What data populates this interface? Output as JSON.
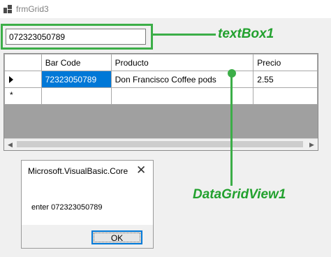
{
  "window": {
    "title": "frmGrid3"
  },
  "textbox": {
    "value": "072323050789"
  },
  "annotations": {
    "textbox_label": "textBox1",
    "grid_label": "DataGridView1",
    "accent": "#3cae48"
  },
  "grid": {
    "columns": [
      "Bar Code",
      "Producto",
      "Precio"
    ],
    "rows": [
      {
        "bar_code": "72323050789",
        "producto": "Don Francisco Coffee pods",
        "precio": "2.55"
      }
    ],
    "new_row_marker": "*",
    "selection_color": "#0078d7"
  },
  "messagebox": {
    "title": "Microsoft.VisualBasic.Core",
    "close_glyph": "✕",
    "text": "enter 072323050789",
    "ok_label": "OK"
  }
}
